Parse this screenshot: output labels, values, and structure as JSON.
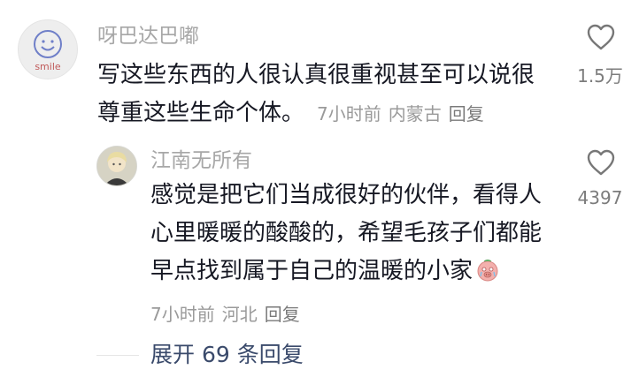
{
  "comments": [
    {
      "username": "呀巴达巴嘟",
      "avatar_text": "smile",
      "lines": [
        "写这些东西的人很认真很重视甚至可以说很",
        "尊重这些生命个体。"
      ],
      "time": "7小时前",
      "location": "内蒙古",
      "reply_label": "回复",
      "likes": "1.5万"
    }
  ],
  "reply": {
    "username": "江南无所有",
    "lines": [
      "感觉是把它们当成很好的伙伴，看得人",
      "心里暖暖的酸酸的，希望毛孩子们都能",
      "早点找到属于自己的温暖的小家"
    ],
    "emoji": "crying-pig-emoji",
    "time": "7小时前",
    "location": "河北",
    "reply_label": "回复",
    "likes": "4397"
  },
  "expand_label": "展开 69 条回复",
  "colors": {
    "text": "#161823",
    "meta": "#9a9a9a",
    "link": "#3a4a6b"
  }
}
